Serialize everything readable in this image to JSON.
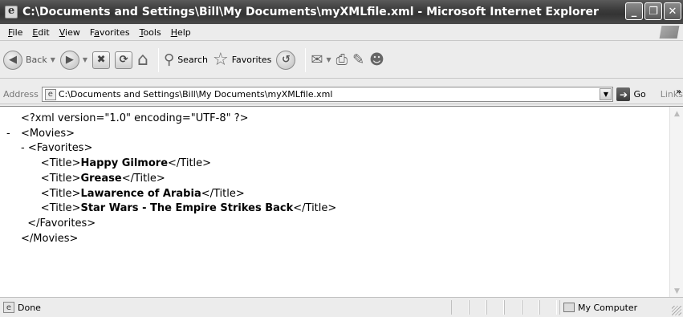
{
  "window": {
    "title": "C:\\Documents and Settings\\Bill\\My Documents\\myXMLfile.xml - Microsoft Internet Explorer",
    "caption_buttons": [
      "minimize",
      "restore",
      "close"
    ]
  },
  "menu": {
    "items": [
      {
        "label": "File",
        "accel": "F",
        "rest": "ile"
      },
      {
        "label": "Edit",
        "accel": "E",
        "rest": "dit"
      },
      {
        "label": "View",
        "accel": "V",
        "rest": "iew"
      },
      {
        "label": "Favorites",
        "pre": "F",
        "accel": "a",
        "rest": "vorites"
      },
      {
        "label": "Tools",
        "accel": "T",
        "rest": "ools"
      },
      {
        "label": "Help",
        "accel": "H",
        "rest": "elp"
      }
    ]
  },
  "toolbar": {
    "back_label": "Back",
    "search_label": "Search",
    "favorites_label": "Favorites"
  },
  "address": {
    "label": "Address",
    "label_accel": "d",
    "value": "C:\\Documents and Settings\\Bill\\My Documents\\myXMLfile.xml",
    "go_label": "Go",
    "links_label": "Links"
  },
  "xml": {
    "declaration": "<?xml version=\"1.0\" encoding=\"UTF-8\" ?>",
    "root_open": "<Movies>",
    "fav_open": "<Favorites>",
    "titles": [
      {
        "open": "<Title>",
        "value": "Happy Gilmore",
        "close": "</Title>"
      },
      {
        "open": "<Title>",
        "value": "Grease",
        "close": "</Title>"
      },
      {
        "open": "<Title>",
        "value": "Lawarence of Arabia",
        "close": "</Title>"
      },
      {
        "open": "<Title>",
        "value": "Star Wars - The Empire Strikes Back",
        "close": "</Title>"
      }
    ],
    "fav_close": "</Favorites>",
    "root_close": "</Movies>",
    "collapse_marker": "-"
  },
  "status": {
    "text": "Done",
    "zone": "My Computer"
  },
  "icons": {
    "app": "ie-page-icon",
    "back": "back-arrow-icon",
    "forward": "forward-arrow-icon",
    "stop": "stop-icon",
    "refresh": "refresh-icon",
    "home": "home-icon",
    "search": "search-icon",
    "favorites": "favorites-star-icon",
    "history": "history-icon",
    "mail": "mail-icon",
    "print": "print-icon",
    "edit": "edit-icon",
    "messenger": "messenger-icon"
  }
}
